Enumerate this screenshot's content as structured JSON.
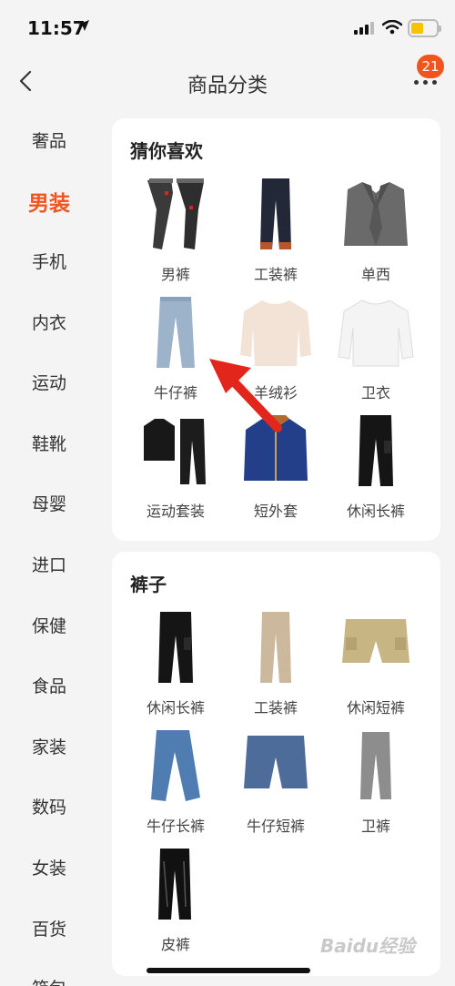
{
  "status_bar": {
    "time": "11:57"
  },
  "nav": {
    "title": "商品分类",
    "badge_count": "21"
  },
  "colors": {
    "accent": "#f2541d",
    "battery": "#f7c200"
  },
  "sidebar": {
    "items": [
      {
        "label": "奢品",
        "active": false
      },
      {
        "label": "男装",
        "active": true
      },
      {
        "label": "手机",
        "active": false
      },
      {
        "label": "内衣",
        "active": false
      },
      {
        "label": "运动",
        "active": false
      },
      {
        "label": "鞋靴",
        "active": false
      },
      {
        "label": "母婴",
        "active": false
      },
      {
        "label": "进口",
        "active": false
      },
      {
        "label": "保健",
        "active": false
      },
      {
        "label": "食品",
        "active": false
      },
      {
        "label": "家装",
        "active": false
      },
      {
        "label": "数码",
        "active": false
      },
      {
        "label": "女装",
        "active": false
      },
      {
        "label": "百货",
        "active": false
      },
      {
        "label": "箱包",
        "active": false
      }
    ]
  },
  "sections": [
    {
      "title": "猜你喜欢",
      "items": [
        {
          "label": "男裤",
          "icon": "mens-pants-image"
        },
        {
          "label": "工装裤",
          "icon": "cargo-pants-image"
        },
        {
          "label": "单西",
          "icon": "blazer-image"
        },
        {
          "label": "牛仔裤",
          "icon": "jeans-image"
        },
        {
          "label": "羊绒衫",
          "icon": "cashmere-sweater-image"
        },
        {
          "label": "卫衣",
          "icon": "sweatshirt-image"
        },
        {
          "label": "运动套装",
          "icon": "tracksuit-image"
        },
        {
          "label": "短外套",
          "icon": "denim-jacket-image"
        },
        {
          "label": "休闲长裤",
          "icon": "casual-pants-image"
        }
      ]
    },
    {
      "title": "裤子",
      "items": [
        {
          "label": "休闲长裤",
          "icon": "casual-pants-image"
        },
        {
          "label": "工装裤",
          "icon": "cargo-pants-image"
        },
        {
          "label": "休闲短裤",
          "icon": "casual-shorts-image"
        },
        {
          "label": "牛仔长裤",
          "icon": "long-jeans-image"
        },
        {
          "label": "牛仔短裤",
          "icon": "denim-shorts-image"
        },
        {
          "label": "卫裤",
          "icon": "sweatpants-image"
        },
        {
          "label": "皮裤",
          "icon": "leather-pants-image"
        }
      ]
    }
  ],
  "watermark": "Baidu经验"
}
